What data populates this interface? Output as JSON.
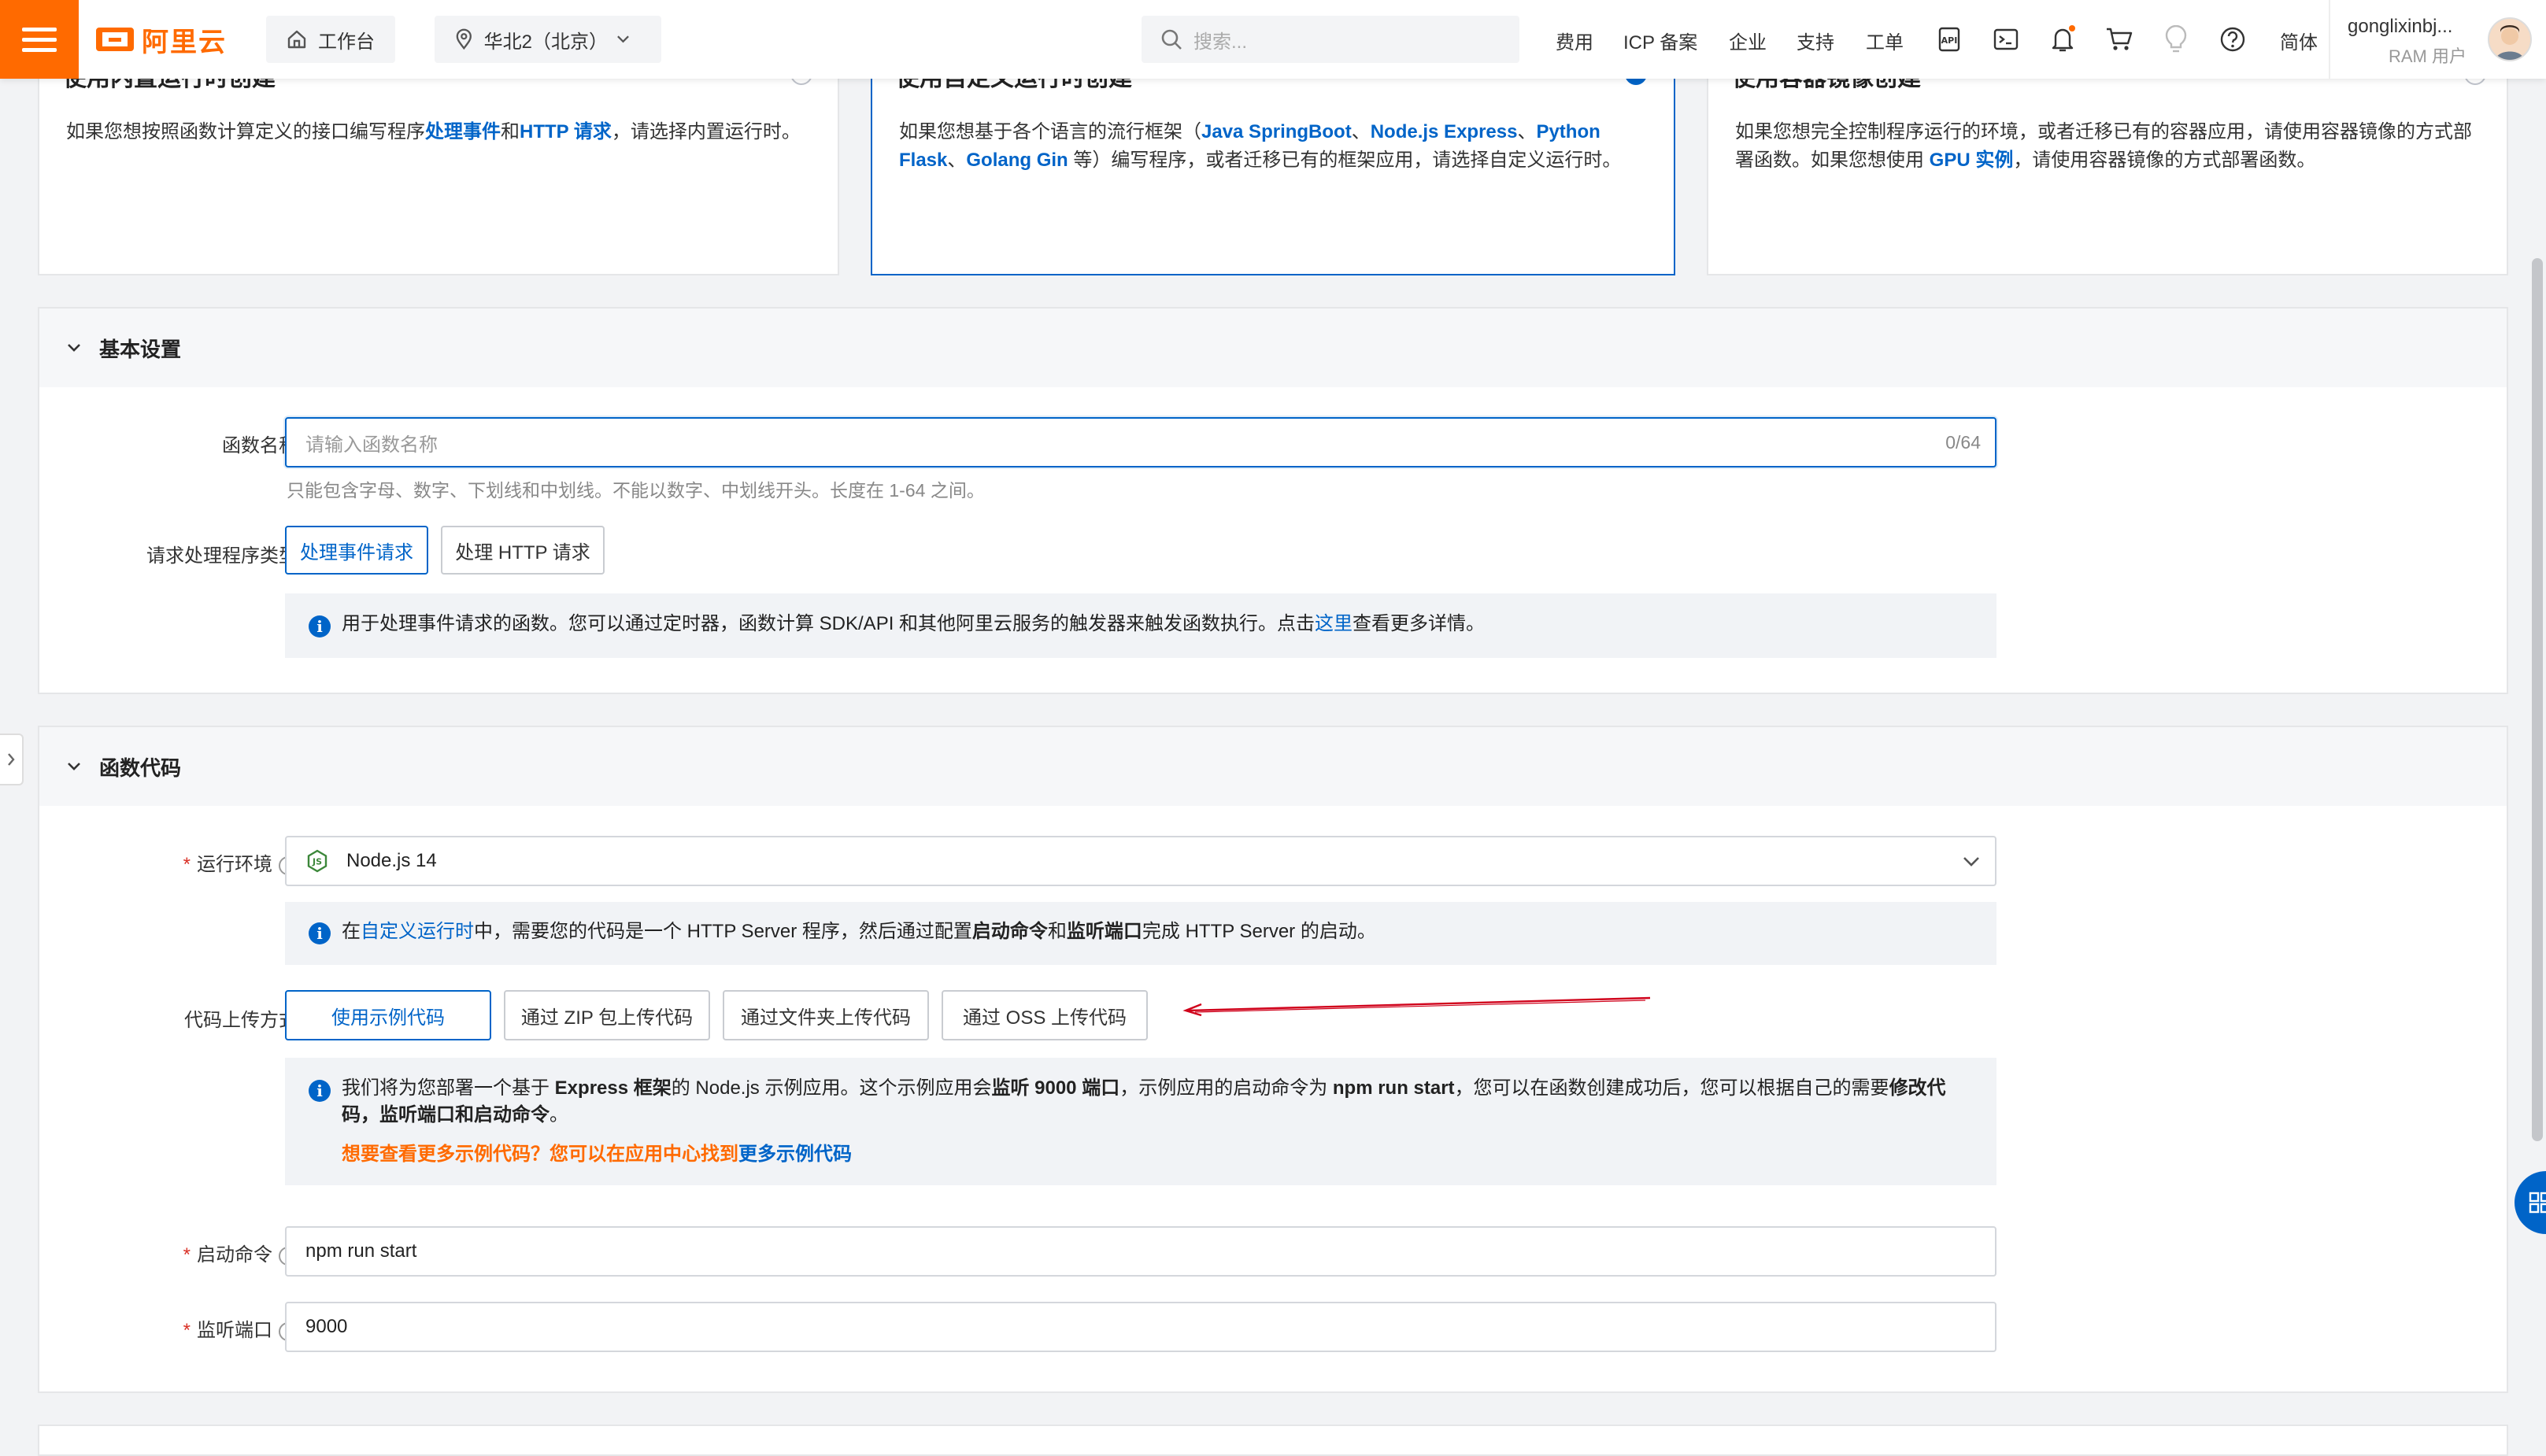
{
  "topbar": {
    "logo_text": "阿里云",
    "workbench": "工作台",
    "region": "华北2（北京）",
    "search_placeholder": "搜索...",
    "links": [
      "费用",
      "ICP 备案",
      "企业",
      "支持",
      "工单"
    ],
    "language": "简体",
    "user_name": "gonglixinbj...",
    "user_role": "RAM 用户",
    "icons": [
      "api-icon",
      "terminal-icon",
      "bell-icon",
      "cart-icon",
      "bulb-icon",
      "help-icon"
    ],
    "accent_color": "#ff6a00"
  },
  "runtime_cards": [
    {
      "title": "使用内置运行时创建",
      "desc_pre": "如果您想按照函数计算定义的接口编写程序",
      "link1": "处理事件",
      "mid": "和",
      "link2": "HTTP 请求",
      "desc_post": "，请选择内置运行时。",
      "selected": false
    },
    {
      "title": "使用自定义运行时创建",
      "desc_pre": "如果您想基于各个语言的流行框架（",
      "fw1": "Java SpringBoot",
      "sep1": "、",
      "fw2": "Node.js Express",
      "sep2": "、",
      "fw3": "Python Flask",
      "sep3": "、",
      "fw4": "Golang Gin",
      "desc_post": " 等）编写程序，或者迁移已有的框架应用，请选择自定义运行时。",
      "selected": true
    },
    {
      "title": "使用容器镜像创建",
      "desc_pre": "如果您想完全控制程序运行的环境，或者迁移已有的容器应用，请使用容器镜像的方式部署函数。如果您想使用 ",
      "link1": "GPU 实例",
      "desc_post": "，请使用容器镜像的方式部署函数。",
      "selected": false
    }
  ],
  "basic": {
    "title": "基本设置",
    "name_label": "函数名称",
    "name_placeholder": "请输入函数名称",
    "name_counter": "0/64",
    "name_hint": "只能包含字母、数字、下划线和中划线。不能以数字、中划线开头。长度在 1-64 之间。",
    "handler_label": "请求处理程序类型",
    "handler_options": [
      "处理事件请求",
      "处理 HTTP 请求"
    ],
    "handler_selected": "处理事件请求",
    "info_pre": "用于处理事件请求的函数。您可以通过定时器，函数计算 SDK/API 和其他阿里云服务的触发器来触发函数执行。点击",
    "info_link": "这里",
    "info_post": "查看更多详情。"
  },
  "code": {
    "title": "函数代码",
    "runtime_label": "运行环境",
    "runtime_value": "Node.js 14",
    "runtime_info_pre": "在",
    "runtime_info_link": "自定义运行时",
    "runtime_info_mid1": "中，需要您的代码是一个 HTTP Server 程序，然后通过配置",
    "runtime_info_b1": "启动命令",
    "runtime_info_mid2": "和",
    "runtime_info_b2": "监听端口",
    "runtime_info_post": "完成 HTTP Server 的启动。",
    "upload_label": "代码上传方式",
    "upload_options": [
      "使用示例代码",
      "通过 ZIP 包上传代码",
      "通过文件夹上传代码",
      "通过 OSS 上传代码"
    ],
    "upload_selected": "使用示例代码",
    "sample_info": {
      "p1": "我们将为您部署一个基于 ",
      "b1": "Express 框架",
      "p2": "的 Node.js 示例应用。这个示例应用会",
      "b2": "监听 9000 端口",
      "p3": "，示例应用的启动命令为 ",
      "b3": "npm run start",
      "p4": "，您可以在函数创建成功后，您可以根据自己的需要",
      "b4": "修改代码，监听端口和启动命令",
      "p5": "。",
      "more_pre": "想要查看更多示例代码？您可以在应用中心找到",
      "more_link": "更多示例代码"
    },
    "start_label": "启动命令",
    "start_value": "npm run start",
    "port_label": "监听端口",
    "port_value": "9000"
  }
}
